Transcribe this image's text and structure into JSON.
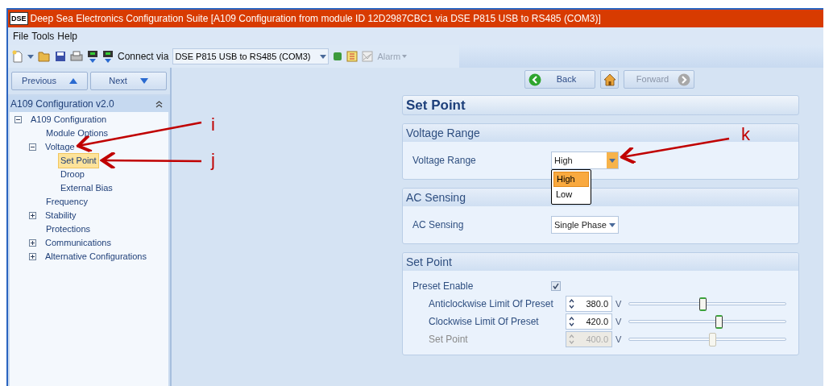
{
  "window": {
    "title": "Deep Sea Electronics Configuration Suite [A109 Configuration from module ID 12D2987CBC1 via DSE P815 USB to RS485 (COM3)]",
    "logo": "DSE"
  },
  "menu": [
    "File",
    "Tools",
    "Help"
  ],
  "toolbar": {
    "connect_label": "Connect via",
    "connection": "DSE P815 USB to RS485 (COM3)",
    "alarm": {
      "label": "Alarm",
      "disabled": true
    }
  },
  "nav_buttons": {
    "previous": "Previous",
    "next": "Next"
  },
  "sidebar": {
    "title": "A109 Configuration v2.0",
    "tree": [
      {
        "label": "A109 Configuration",
        "expanded": true,
        "selected": false,
        "children": [
          {
            "label": "Module Options",
            "selected": false
          },
          {
            "label": "Voltage",
            "expanded": true,
            "selected": false,
            "children": [
              {
                "label": "Set Point",
                "selected": true
              },
              {
                "label": "Droop",
                "selected": false
              },
              {
                "label": "External Bias",
                "selected": false
              }
            ]
          },
          {
            "label": "Frequency",
            "selected": false
          },
          {
            "label": "Stability",
            "expanded": false,
            "selected": false
          },
          {
            "label": "Protections",
            "selected": false
          },
          {
            "label": "Communications",
            "expanded": false,
            "selected": false
          },
          {
            "label": "Alternative Configurations",
            "expanded": false,
            "selected": false
          }
        ]
      }
    ]
  },
  "page_nav": [
    {
      "label": "Back",
      "kind": "back",
      "disabled": false
    },
    {
      "kind": "home",
      "disabled": false
    },
    {
      "label": "Forward",
      "kind": "forward",
      "disabled": true
    }
  ],
  "page": {
    "title": "Set Point",
    "sections": [
      {
        "title": "Voltage Range",
        "rows": [
          {
            "kind": "dropdown",
            "label": "Voltage Range",
            "value": "High",
            "open": true,
            "options": [
              {
                "label": "High",
                "selected": true
              },
              {
                "label": "Low",
                "selected": false
              }
            ]
          }
        ]
      },
      {
        "title": "AC Sensing",
        "rows": [
          {
            "kind": "dropdown",
            "label": "AC Sensing",
            "value": "Single Phase",
            "open": false
          }
        ]
      },
      {
        "title": "Set Point",
        "rows": [
          {
            "kind": "checkbox",
            "label": "Preset Enable",
            "checked": true
          },
          {
            "kind": "slider",
            "label": "Anticlockwise Limit Of Preset",
            "value": "380.0",
            "unit": "V",
            "level": 0.47,
            "disabled": false
          },
          {
            "kind": "slider",
            "label": "Clockwise Limit Of Preset",
            "value": "420.0",
            "unit": "V",
            "level": 0.57,
            "disabled": false
          },
          {
            "kind": "slider",
            "label": "Set Point",
            "value": "400.0",
            "unit": "V",
            "level": 0.53,
            "disabled": true
          }
        ]
      }
    ]
  },
  "annotations": [
    {
      "label": "i"
    },
    {
      "label": "j"
    },
    {
      "label": "k"
    }
  ]
}
